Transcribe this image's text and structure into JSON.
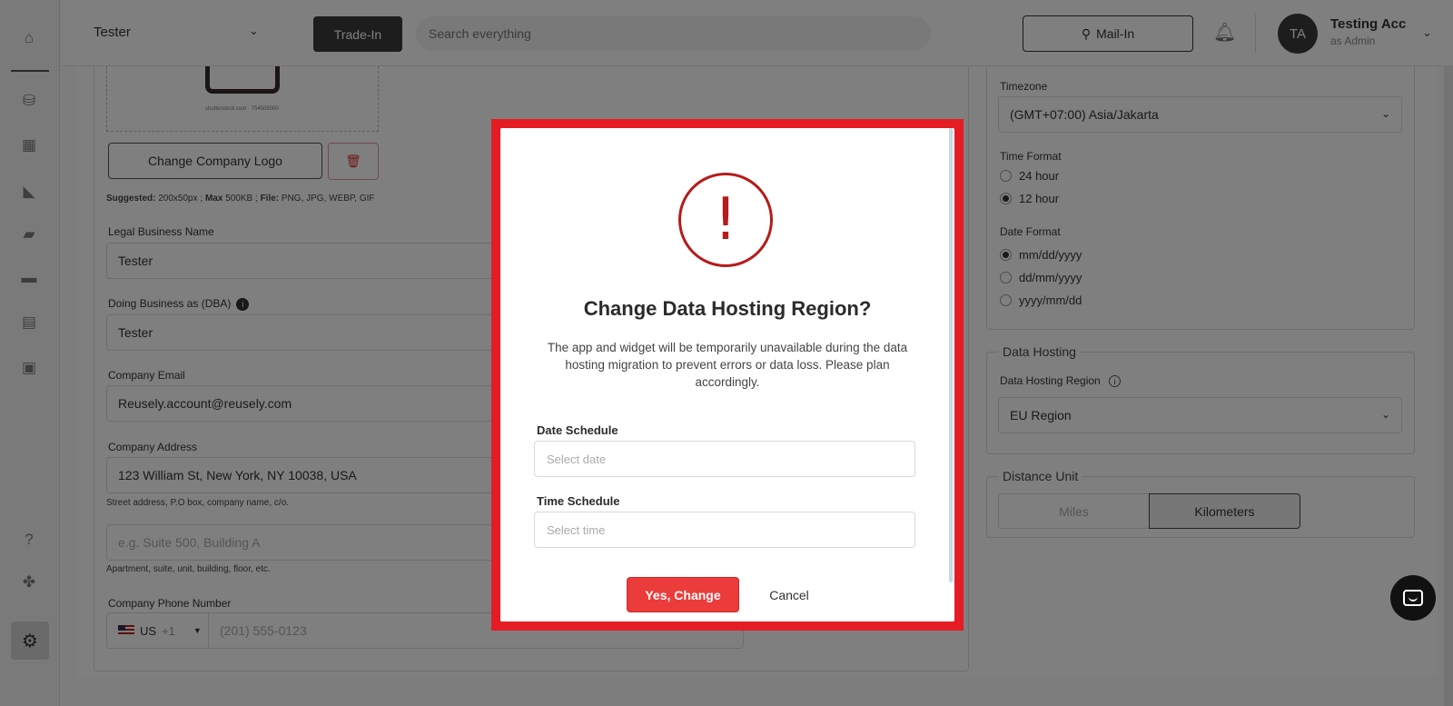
{
  "topbar": {
    "store_name": "Tester",
    "tradein_label": "Trade-In",
    "search_placeholder": "Search everything",
    "mailin_label": "Mail-In",
    "avatar_initials": "TA",
    "user_name": "Testing Acc",
    "user_role": "as Admin"
  },
  "company": {
    "logo_caption": "shutterstock.com · 754505000",
    "change_logo_label": "Change Company Logo",
    "logo_hint_suggested_label": "Suggested:",
    "logo_hint_suggested": "200x50px ;",
    "logo_hint_max_label": "Max",
    "logo_hint_max": "500KB ;",
    "logo_hint_file_label": "File:",
    "logo_hint_file": "PNG, JPG, WEBP, GIF",
    "legal_name_label": "Legal Business Name",
    "legal_name_value": "Tester",
    "dba_label": "Doing Business as (DBA)",
    "dba_value": "Tester",
    "email_label": "Company Email",
    "email_value": "Reusely.account@reusely.com",
    "address_label": "Company Address",
    "address_value": "123 William St, New York, NY 10038, USA",
    "address_hint": "Street address, P.O box, company name, c/o.",
    "address2_placeholder": "e.g. Suite 500, Building A",
    "address2_hint": "Apartment, suite, unit, building, floor, etc.",
    "phone_label": "Company Phone Number",
    "phone_country": "US",
    "phone_code": "+1",
    "phone_placeholder": "(201) 555-0123"
  },
  "settings": {
    "timezone_label": "Timezone",
    "timezone_value": "(GMT+07:00) Asia/Jakarta",
    "time_format_label": "Time Format",
    "time_formats": [
      {
        "label": "24 hour",
        "selected": false
      },
      {
        "label": "12 hour",
        "selected": true
      }
    ],
    "date_format_label": "Date Format",
    "date_formats": [
      {
        "label": "mm/dd/yyyy",
        "selected": true
      },
      {
        "label": "dd/mm/yyyy",
        "selected": false
      },
      {
        "label": "yyyy/mm/dd",
        "selected": false
      }
    ],
    "hosting_legend": "Data Hosting",
    "hosting_region_label": "Data Hosting Region",
    "hosting_region_value": "EU Region",
    "distance_legend": "Distance Unit",
    "distance_options": [
      "Miles",
      "Kilometers"
    ],
    "distance_selected": "Kilometers"
  },
  "modal": {
    "icon": "exclamation-icon",
    "title": "Change Data Hosting Region?",
    "description": "The app and widget will be temporarily unavailable during the data hosting migration to prevent errors or data loss. Please plan accordingly.",
    "date_label": "Date Schedule",
    "date_placeholder": "Select date",
    "time_label": "Time Schedule",
    "time_placeholder": "Select time",
    "confirm_label": "Yes, Change",
    "cancel_label": "Cancel"
  },
  "colors": {
    "highlight": "#e51c23",
    "confirm": "#ec3b3b",
    "warning": "#b51b1b",
    "dark": "#3a3a3a"
  }
}
